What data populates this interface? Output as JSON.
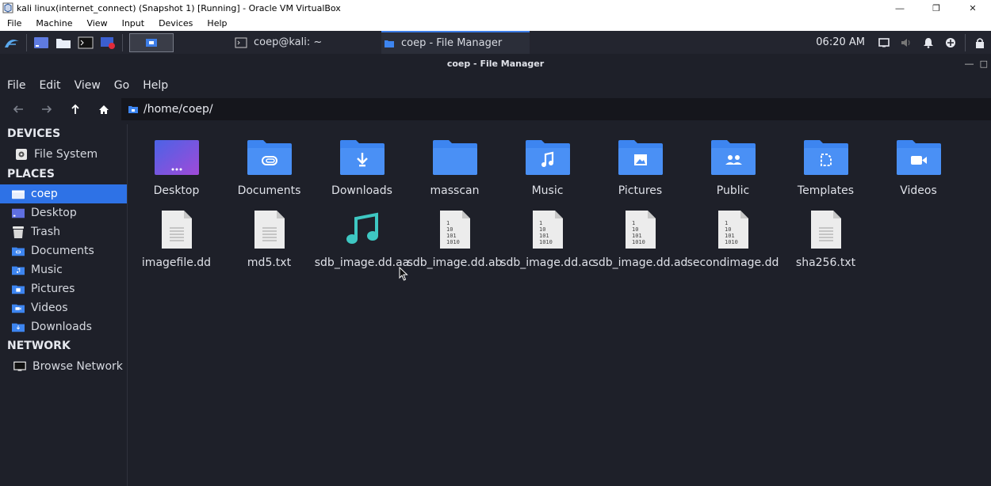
{
  "vbox": {
    "title": "kali linux(internet_connect) (Snapshot 1) [Running] - Oracle VM VirtualBox",
    "menu": [
      "File",
      "Machine",
      "View",
      "Input",
      "Devices",
      "Help"
    ]
  },
  "panel": {
    "tasks": [
      {
        "label": "coep@kali: ~",
        "icon": "terminal-icon"
      },
      {
        "label": "coep - File Manager",
        "icon": "folder-icon"
      }
    ],
    "clock": "06:20 AM"
  },
  "fm": {
    "title": "coep - File Manager",
    "menu": [
      "File",
      "Edit",
      "View",
      "Go",
      "Help"
    ],
    "location": "/home/coep/"
  },
  "sidebar": {
    "devices_heading": "DEVICES",
    "devices": [
      {
        "label": "File System",
        "icon": "drive-icon"
      }
    ],
    "places_heading": "PLACES",
    "places": [
      {
        "label": "coep",
        "icon": "home-folder-icon"
      },
      {
        "label": "Desktop",
        "icon": "desktop-icon"
      },
      {
        "label": "Trash",
        "icon": "trash-icon"
      },
      {
        "label": "Documents",
        "icon": "documents-icon"
      },
      {
        "label": "Music",
        "icon": "music-icon"
      },
      {
        "label": "Pictures",
        "icon": "pictures-icon"
      },
      {
        "label": "Videos",
        "icon": "videos-icon"
      },
      {
        "label": "Downloads",
        "icon": "downloads-icon"
      }
    ],
    "network_heading": "NETWORK",
    "network": [
      {
        "label": "Browse Network",
        "icon": "network-icon"
      }
    ]
  },
  "files": [
    {
      "label": "Desktop",
      "icon": "desktop-folder-icon"
    },
    {
      "label": "Documents",
      "icon": "documents-folder-icon"
    },
    {
      "label": "Downloads",
      "icon": "downloads-folder-icon"
    },
    {
      "label": "masscan",
      "icon": "folder-icon"
    },
    {
      "label": "Music",
      "icon": "music-folder-icon"
    },
    {
      "label": "Pictures",
      "icon": "pictures-folder-icon"
    },
    {
      "label": "Public",
      "icon": "public-folder-icon"
    },
    {
      "label": "Templates",
      "icon": "templates-folder-icon"
    },
    {
      "label": "Videos",
      "icon": "videos-folder-icon"
    },
    {
      "label": "imagefile.dd",
      "icon": "text-file-icon"
    },
    {
      "label": "md5.txt",
      "icon": "text-file-icon"
    },
    {
      "label": "sdb_image.dd.aa",
      "icon": "audio-file-icon"
    },
    {
      "label": "sdb_image.dd.ab",
      "icon": "binary-file-icon"
    },
    {
      "label": "sdb_image.dd.ac",
      "icon": "binary-file-icon"
    },
    {
      "label": "sdb_image.dd.ad",
      "icon": "binary-file-icon"
    },
    {
      "label": "secondimage.dd",
      "icon": "binary-file-icon"
    },
    {
      "label": "sha256.txt",
      "icon": "text-file-icon"
    }
  ],
  "binary_glyph": [
    "1",
    "10",
    "101",
    "1010"
  ],
  "colors": {
    "accent": "#2e72e6",
    "folder": "#3d85f0",
    "audio": "#3ec7c2"
  }
}
